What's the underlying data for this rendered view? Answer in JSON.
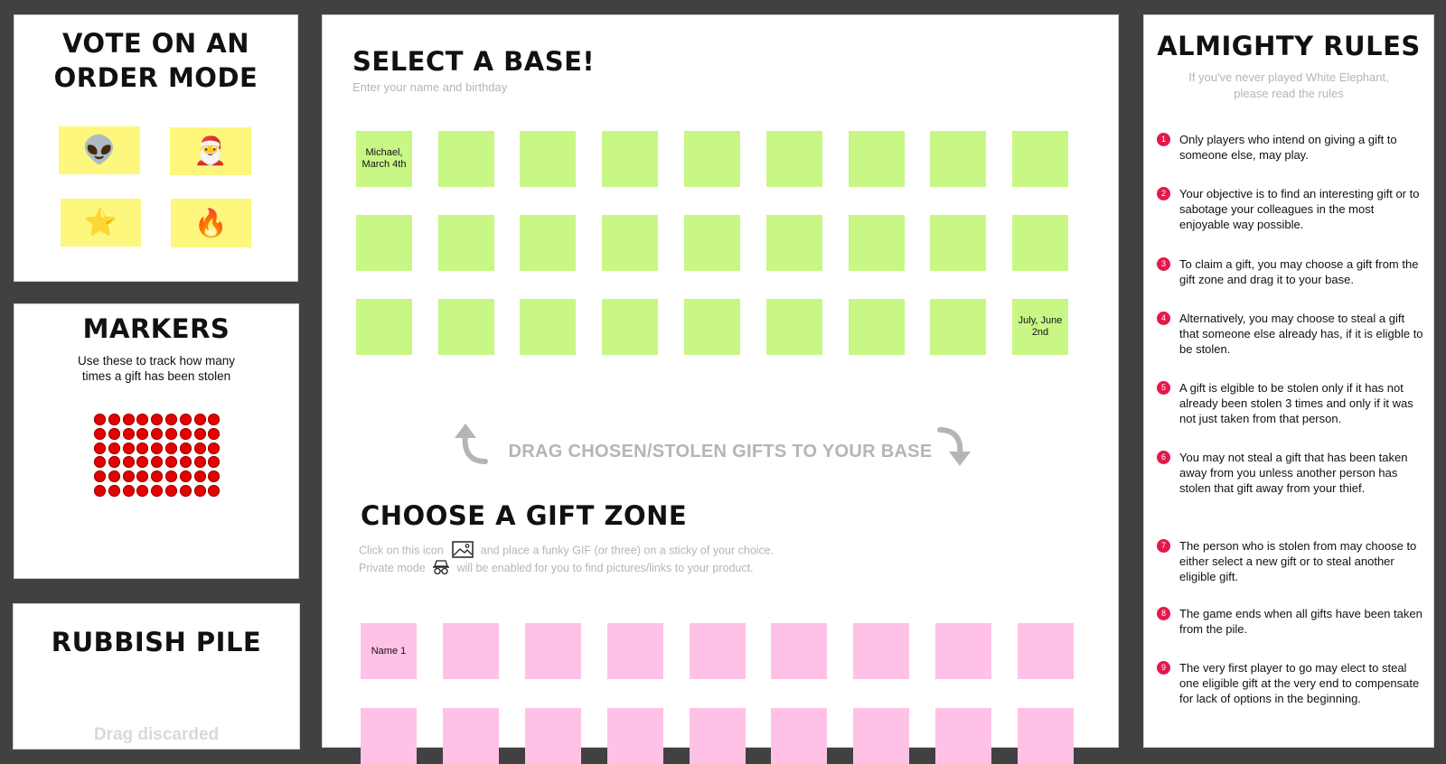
{
  "vote_panel": {
    "title_line1": "VOTE ON AN",
    "title_line2": "ORDER MODE",
    "options": [
      "👽",
      "🎅",
      "⭐",
      "🔥"
    ]
  },
  "markers_panel": {
    "title": "MARKERS",
    "desc_line1": "Use these to track how many",
    "desc_line2": "times a gift has been stolen"
  },
  "rubbish_panel": {
    "title": "RUBBISH PILE",
    "hint": "Drag discarded"
  },
  "base_section": {
    "title": "SELECT A BASE!",
    "subtitle": "Enter your name and birthday",
    "stickies": [
      "Michael,\nMarch 4th",
      "",
      "",
      "",
      "",
      "",
      "",
      "",
      "",
      "",
      "",
      "",
      "",
      "",
      "",
      "",
      "",
      "",
      "",
      "",
      "",
      "",
      "",
      "",
      "",
      "",
      "July, June\n2nd"
    ]
  },
  "drag_banner": {
    "text": "DRAG CHOSEN/STOLEN GIFTS TO YOUR BASE"
  },
  "gift_section": {
    "title": "CHOOSE A GIFT ZONE",
    "line1_a": "Click on this icon",
    "line1_b": "and place a funky GIF (or three) on a sticky of your choice.",
    "line2_a": "Private mode",
    "line2_b": "will be enabled for you to find pictures/links to your product.",
    "icons": [
      "image-icon",
      "incognito-icon"
    ],
    "stickies": [
      "Name 1",
      "",
      "",
      "",
      "",
      "",
      "",
      "",
      "",
      "",
      "",
      "",
      "",
      "",
      "",
      "",
      "",
      ""
    ]
  },
  "rules_panel": {
    "title": "ALMIGHTY RULES",
    "subtitle_line1": "If you've never played White Elephant,",
    "subtitle_line2": "please read the rules",
    "rules": [
      "Only players who intend on giving a gift to someone else, may play.",
      "Your objective is to find an interesting gift or to sabotage your colleagues in the most enjoyable way possible.",
      "To claim a gift, you may choose a gift from the gift zone and drag it to your base.",
      "Alternatively, you may choose to steal a gift that someone else already has, if it is eligble to be stolen.",
      "A gift is elgible to be stolen only if it has not already been stolen 3 times and only if it was not just taken from that person.",
      "You may not steal a gift that has been taken away from you unless another person has stolen that gift away from your thief.",
      "The person who is stolen from may choose to either select a new gift or to steal another eligible gift.",
      "The game ends when all gifts have been taken from the pile.",
      "The very first player to go may elect to steal one eligible gift at the very end to compensate for lack of options in the beginning."
    ],
    "numbers": [
      "1",
      "2",
      "3",
      "4",
      "5",
      "6",
      "7",
      "8",
      "9"
    ]
  },
  "colors": {
    "base_sticky": "#c8f785",
    "gift_sticky": "#ffc2e6",
    "vote_sticky": "#fdf77d",
    "marker": "#e60000",
    "rule_badge": "#e3194a",
    "canvas_bg": "#414141"
  }
}
